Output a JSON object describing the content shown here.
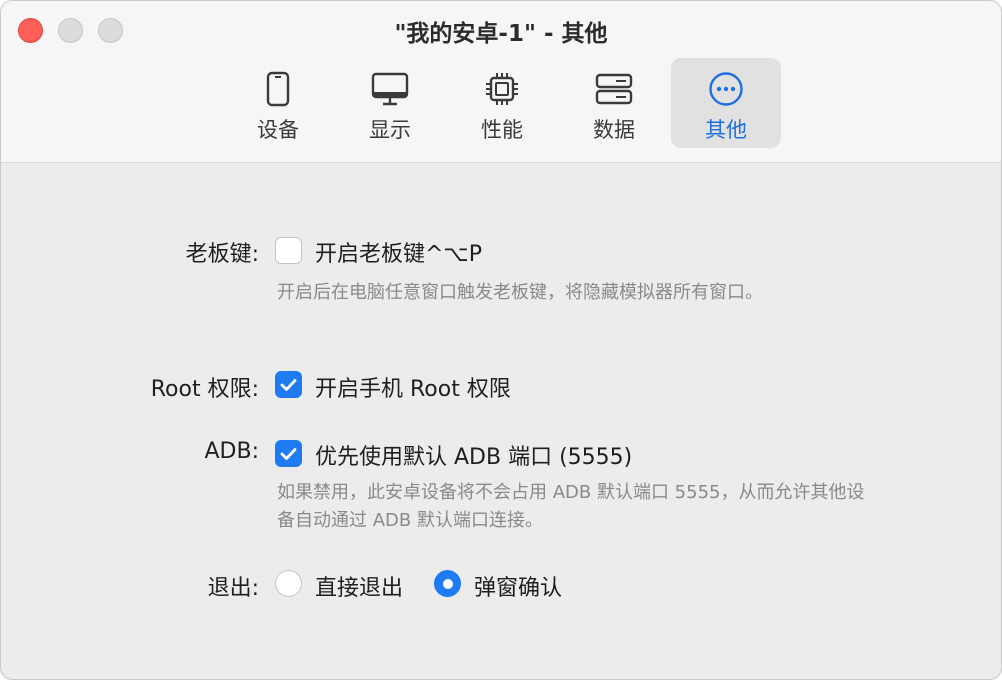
{
  "window": {
    "title": "\"我的安卓-1\" - 其他"
  },
  "toolbar": {
    "tabs": [
      {
        "label": "设备",
        "icon": "phone-icon"
      },
      {
        "label": "显示",
        "icon": "monitor-icon"
      },
      {
        "label": "性能",
        "icon": "cpu-chip-icon"
      },
      {
        "label": "数据",
        "icon": "storage-icon"
      },
      {
        "label": "其他",
        "icon": "more-ellipsis-icon"
      }
    ],
    "active_tab": "其他"
  },
  "settings": {
    "boss_key": {
      "label": "老板键:",
      "option": "开启老板键^⌥P",
      "checked": false,
      "description": "开启后在电脑任意窗口触发老板键，将隐藏模拟器所有窗口。"
    },
    "root": {
      "label": "Root 权限:",
      "option": "开启手机 Root 权限",
      "checked": true
    },
    "adb": {
      "label": "ADB:",
      "option": "优先使用默认 ADB 端口 (5555)",
      "checked": true,
      "description": "如果禁用，此安卓设备将不会占用 ADB 默认端口 5555，从而允许其他设备自动通过 ADB 默认端口连接。"
    },
    "exit": {
      "label": "退出:",
      "options": [
        "直接退出",
        "弹窗确认"
      ],
      "selected": "弹窗确认"
    }
  },
  "colors": {
    "accent": "#1f7bf3",
    "close": "#fe5f57"
  }
}
